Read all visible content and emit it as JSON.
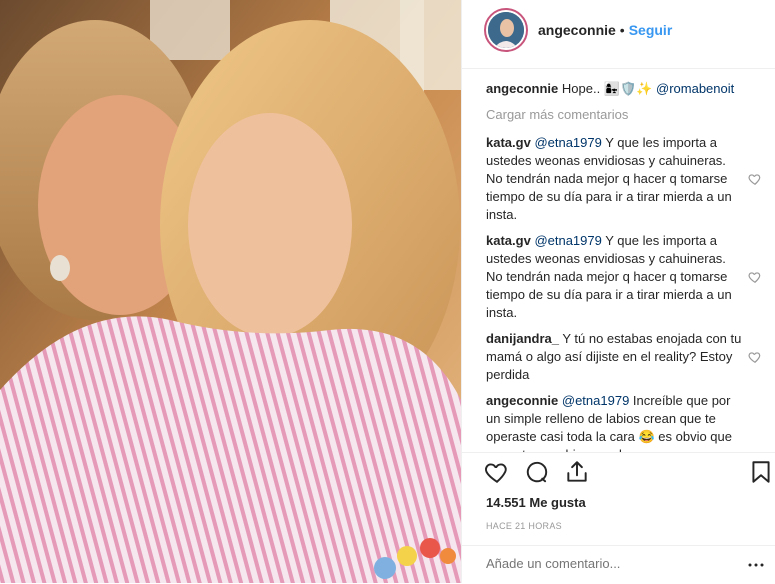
{
  "header": {
    "username": "angeconnie",
    "separator": "•",
    "follow_label": "Seguir"
  },
  "caption": {
    "username": "angeconnie",
    "text": "Hope..",
    "emojis": "👩‍👧🛡️✨",
    "mention": "@romabenoit"
  },
  "load_more_label": "Cargar más comentarios",
  "comments": [
    {
      "username": "kata.gv",
      "mention": "@etna1979",
      "text": "Y que les importa a ustedes weonas envidiosas y cahuineras. No tendrán nada mejor q hacer q tomarse tiempo de su día para ir a tirar mierda a un insta."
    },
    {
      "username": "kata.gv",
      "mention": "@etna1979",
      "text": "Y que les importa a ustedes weonas envidiosas y cahuineras. No tendrán nada mejor q hacer q tomarse tiempo de su día para ir a tirar mierda a un insta."
    },
    {
      "username": "danijandra_",
      "mention": "",
      "text": "Y tú no estabas enojada con tu mamá o algo así dijiste en el reality? Estoy perdida"
    },
    {
      "username": "angeconnie",
      "mention": "@etna1979",
      "text": "Increíble que por un simple relleno de labios crean que te operaste casi toda la cara 😂 es obvio que un rostro cambia cuando"
    }
  ],
  "actions": {
    "likes_label": "14.551 Me gusta",
    "timestamp": "HACE 21 HORAS",
    "add_comment_placeholder": "Añade un comentario...",
    "icons": [
      "heart-icon",
      "comment-icon",
      "share-icon",
      "bookmark-icon",
      "more-icon"
    ]
  },
  "colors": {
    "link": "#3897f0",
    "mention": "#003569",
    "muted": "#999999",
    "border": "#efefef"
  }
}
